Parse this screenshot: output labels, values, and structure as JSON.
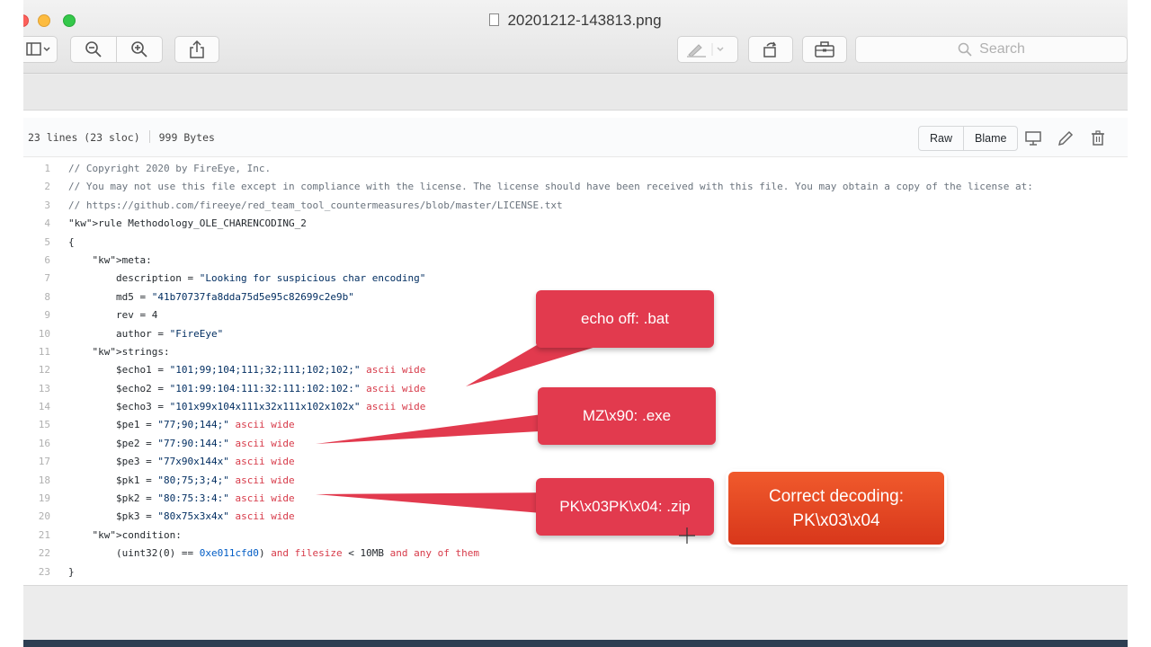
{
  "window": {
    "title": "20201212-143813.png"
  },
  "toolbar": {
    "search_placeholder": "Search"
  },
  "file": {
    "line_info": "23 lines (23 sloc)",
    "size": "999 Bytes",
    "raw_label": "Raw",
    "blame_label": "Blame"
  },
  "code_lines": [
    "// Copyright 2020 by FireEye, Inc.",
    "// You may not use this file except in compliance with the license. The license should have been received with this file. You may obtain a copy of the license at:",
    "// https://github.com/fireeye/red_team_tool_countermeasures/blob/master/LICENSE.txt",
    "rule Methodology_OLE_CHARENCODING_2",
    "{",
    "    meta:",
    "        description = \"Looking for suspicious char encoding\"",
    "        md5 = \"41b70737fa8dda75d5e95c82699c2e9b\"",
    "        rev = 4",
    "        author = \"FireEye\"",
    "    strings:",
    "        $echo1 = \"101;99;104;111;32;111;102;102;\" ascii wide",
    "        $echo2 = \"101:99:104:111:32:111:102:102:\" ascii wide",
    "        $echo3 = \"101x99x104x111x32x111x102x102x\" ascii wide",
    "        $pe1 = \"77;90;144;\" ascii wide",
    "        $pe2 = \"77:90:144:\" ascii wide",
    "        $pe3 = \"77x90x144x\" ascii wide",
    "        $pk1 = \"80;75;3;4;\" ascii wide",
    "        $pk2 = \"80:75:3:4:\" ascii wide",
    "        $pk3 = \"80x75x3x4x\" ascii wide",
    "    condition:",
    "        (uint32(0) == 0xe011cfd0) and filesize < 10MB and any of them",
    "}"
  ],
  "callouts": {
    "echo": "echo off: .bat",
    "mz": "MZ\\x90: .exe",
    "pk": "PK\\x03PK\\x04: .zip",
    "correct_line1": "Correct decoding:",
    "correct_line2": "PK\\x03\\x04"
  },
  "colors": {
    "callout_red": "#e23a4e",
    "callout_orange": "#e84a24",
    "keyword": "#d73a49",
    "comment": "#6a737d"
  }
}
